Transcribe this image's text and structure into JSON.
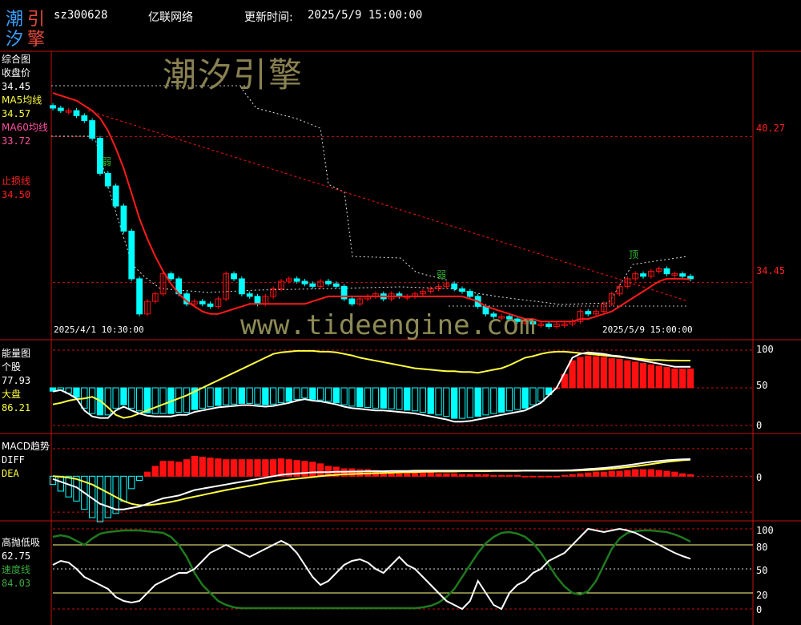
{
  "header": {
    "logo_chars": [
      "潮",
      "引",
      "汐",
      "擎"
    ],
    "stock_code": "sz300628",
    "stock_name": "亿联网络",
    "update_label": "更新时间:",
    "update_time": "2025/5/9 15:00:00"
  },
  "watermarks": {
    "brand": "潮汐引擎",
    "url": "www.tideengine.com"
  },
  "colors": {
    "up": "#ff1010",
    "down": "#00ffff",
    "ma60": "#ff1010",
    "diff": "#ffffff",
    "dea": "#ffff40",
    "speed": "#1f7a1f",
    "grid": "#c41010"
  },
  "panels": {
    "main": {
      "title": "综合图",
      "close_label": "收盘价",
      "close_value": "34.45",
      "ma5_label": "MA5均线",
      "ma5_value": "34.57",
      "ma60_label": "MA60均线",
      "ma60_value": "33.72",
      "stop_label": "止损线",
      "stop_value": "34.50",
      "right_axis": [
        "40.27",
        "34.45"
      ],
      "start_time": "2025/4/1 10:30:00",
      "end_time": "2025/5/9 15:00:00",
      "annotations": [
        "弱",
        "弱",
        "顶"
      ]
    },
    "energy": {
      "title": "能量图",
      "stock_label": "个股",
      "stock_value": "77.93",
      "market_label": "大盘",
      "market_value": "86.21",
      "right_axis": [
        "100",
        "50",
        "0"
      ]
    },
    "macd": {
      "title": "MACD趋势",
      "diff_label": "DIFF",
      "dea_label": "DEA",
      "right_axis": [
        "0"
      ]
    },
    "highlow": {
      "title": "高抛低吸",
      "value": "62.75",
      "speed_label": "速度线",
      "speed_value": "84.03",
      "right_axis": [
        "100",
        "80",
        "50",
        "20",
        "0"
      ]
    }
  },
  "chart_data": [
    {
      "type": "candlestick",
      "title": "综合图",
      "ylim": [
        32.3,
        43.6
      ],
      "x_start": "2025/4/1 10:30:00",
      "x_end": "2025/5/9 15:00:00",
      "close": [
        41.4,
        41.3,
        41.3,
        41.1,
        40.9,
        40.2,
        38.8,
        38.3,
        37.5,
        36.5,
        34.6,
        33.2,
        33.7,
        34.0,
        34.8,
        34.6,
        34.0,
        33.6,
        33.7,
        33.6,
        33.5,
        33.8,
        34.8,
        34.6,
        34.0,
        33.9,
        33.6,
        33.9,
        34.2,
        34.5,
        34.6,
        34.5,
        34.4,
        34.3,
        34.5,
        34.4,
        34.3,
        33.8,
        33.6,
        33.8,
        33.9,
        34.0,
        33.8,
        34.0,
        33.9,
        33.9,
        34.0,
        34.1,
        34.2,
        34.3,
        34.4,
        34.2,
        34.1,
        33.9,
        33.5,
        33.2,
        33.1,
        33.1,
        33.0,
        32.9,
        32.9,
        32.8,
        32.8,
        32.7,
        32.8,
        32.8,
        32.9,
        33.3,
        33.2,
        33.3,
        33.6,
        34.0,
        34.3,
        34.6,
        34.8,
        34.7,
        34.9,
        35.0,
        34.8,
        34.8,
        34.7,
        34.6
      ],
      "ma5": [
        42.0,
        41.9,
        41.8,
        41.7,
        41.5,
        41.3,
        41.0,
        40.5,
        39.8,
        39.0,
        38.0,
        37.0,
        36.2,
        35.5,
        34.9,
        34.4,
        34.0,
        33.7,
        33.5,
        33.3,
        33.2,
        33.2,
        33.3,
        33.4,
        33.5,
        33.6,
        33.6,
        33.6,
        33.6,
        33.6,
        33.6,
        33.6,
        33.6,
        33.7,
        33.8,
        33.9,
        33.9,
        33.9,
        33.9,
        33.9,
        33.9,
        33.9,
        33.9,
        33.9,
        33.9,
        33.9,
        33.9,
        33.9,
        33.9,
        33.9,
        33.9,
        33.9,
        33.9,
        33.8,
        33.7,
        33.5,
        33.4,
        33.3,
        33.2,
        33.1,
        33.0,
        33.0,
        32.9,
        32.9,
        32.9,
        32.9,
        32.9,
        33.0,
        33.0,
        33.1,
        33.2,
        33.3,
        33.5,
        33.7,
        33.9,
        34.1,
        34.3,
        34.5,
        34.6,
        34.6,
        34.6,
        34.57
      ],
      "ma60_range": [
        41.3,
        33.72
      ],
      "stop_line": [
        41.5,
        34.5
      ],
      "annotation_values": {
        "弱": 38.0,
        "顶": 35.1
      }
    },
    {
      "type": "bar+line",
      "title": "能量图",
      "ylim": [
        0,
        100
      ],
      "ticks": [
        0,
        50,
        100
      ],
      "series_names": [
        "个股",
        "大盘"
      ],
      "stock": [
        45,
        47,
        42,
        36,
        20,
        12,
        10,
        10,
        20,
        25,
        20,
        16,
        13,
        12,
        12,
        12,
        14,
        14,
        18,
        20,
        22,
        24,
        25,
        26,
        27,
        27,
        26,
        25,
        26,
        28,
        30,
        33,
        35,
        33,
        32,
        30,
        28,
        25,
        23,
        22,
        21,
        20,
        20,
        19,
        18,
        17,
        16,
        14,
        12,
        10,
        8,
        5,
        5,
        6,
        8,
        10,
        12,
        14,
        16,
        18,
        20,
        25,
        30,
        40,
        50,
        70,
        90,
        95,
        97,
        96,
        95,
        93,
        92,
        90,
        88,
        86,
        84,
        82,
        80,
        78,
        77.93,
        77.93
      ],
      "market": [
        28,
        30,
        33,
        35,
        36,
        38,
        33,
        24,
        14,
        10,
        12,
        16,
        20,
        24,
        28,
        32,
        36,
        40,
        45,
        50,
        55,
        60,
        65,
        70,
        75,
        80,
        85,
        90,
        95,
        97,
        98,
        99,
        99,
        99,
        98,
        98,
        97,
        95,
        93,
        90,
        88,
        86,
        84,
        82,
        80,
        78,
        76,
        75,
        74,
        73,
        72,
        72,
        71,
        71,
        70,
        72,
        74,
        76,
        80,
        85,
        90,
        92,
        95,
        97,
        98,
        98,
        97,
        96,
        95,
        94,
        93,
        92,
        91,
        90,
        89,
        88,
        87,
        87,
        86.5,
        86.3,
        86.21,
        86.21
      ]
    },
    {
      "type": "bar+line",
      "title": "MACD趋势",
      "ylim": [
        -1.5,
        1.2
      ],
      "series_names": [
        "DIFF",
        "DEA"
      ],
      "diff": [
        -0.1,
        -0.2,
        -0.3,
        -0.4,
        -0.6,
        -0.8,
        -1.0,
        -1.1,
        -1.2,
        -1.2,
        -1.15,
        -1.1,
        -1.0,
        -0.9,
        -0.8,
        -0.75,
        -0.7,
        -0.6,
        -0.5,
        -0.45,
        -0.4,
        -0.35,
        -0.3,
        -0.25,
        -0.2,
        -0.15,
        -0.1,
        -0.05,
        0,
        0.05,
        0.08,
        0.1,
        0.12,
        0.14,
        0.15,
        0.15,
        0.16,
        0.16,
        0.17,
        0.17,
        0.18,
        0.18,
        0.18,
        0.19,
        0.19,
        0.19,
        0.2,
        0.2,
        0.2,
        0.2,
        0.2,
        0.2,
        0.2,
        0.2,
        0.2,
        0.2,
        0.2,
        0.2,
        0.2,
        0.2,
        0.2,
        0.2,
        0.2,
        0.2,
        0.2,
        0.21,
        0.22,
        0.24,
        0.26,
        0.28,
        0.3,
        0.33,
        0.36,
        0.4,
        0.44,
        0.48,
        0.52,
        0.55,
        0.58,
        0.6,
        0.61,
        0.62
      ],
      "dea": [
        0.0,
        -0.02,
        -0.05,
        -0.1,
        -0.2,
        -0.3,
        -0.45,
        -0.6,
        -0.75,
        -0.9,
        -1.0,
        -1.05,
        -1.05,
        -1.02,
        -0.98,
        -0.93,
        -0.87,
        -0.8,
        -0.74,
        -0.68,
        -0.62,
        -0.56,
        -0.5,
        -0.45,
        -0.4,
        -0.35,
        -0.3,
        -0.25,
        -0.2,
        -0.16,
        -0.12,
        -0.09,
        -0.06,
        -0.03,
        0,
        0.03,
        0.05,
        0.07,
        0.08,
        0.09,
        0.1,
        0.11,
        0.12,
        0.13,
        0.14,
        0.15,
        0.15,
        0.16,
        0.16,
        0.17,
        0.17,
        0.17,
        0.18,
        0.18,
        0.18,
        0.18,
        0.19,
        0.19,
        0.19,
        0.19,
        0.2,
        0.2,
        0.2,
        0.2,
        0.2,
        0.2,
        0.2,
        0.21,
        0.22,
        0.23,
        0.25,
        0.27,
        0.3,
        0.33,
        0.36,
        0.4,
        0.44,
        0.48,
        0.52,
        0.55,
        0.58,
        0.6
      ]
    },
    {
      "type": "line",
      "title": "高抛低吸",
      "ylim": [
        0,
        100
      ],
      "ticks": [
        0,
        20,
        50,
        80,
        100
      ],
      "series_names": [
        "高抛低吸",
        "速度线"
      ],
      "value": [
        55,
        60,
        58,
        50,
        40,
        35,
        30,
        25,
        15,
        10,
        8,
        10,
        20,
        30,
        35,
        40,
        45,
        45,
        50,
        60,
        70,
        75,
        80,
        75,
        70,
        65,
        70,
        75,
        80,
        85,
        80,
        70,
        55,
        40,
        30,
        35,
        45,
        55,
        60,
        62,
        58,
        50,
        45,
        55,
        65,
        55,
        50,
        40,
        30,
        20,
        10,
        5,
        0,
        10,
        35,
        20,
        5,
        0,
        20,
        30,
        35,
        45,
        50,
        60,
        65,
        70,
        80,
        90,
        100,
        98,
        96,
        98,
        100,
        98,
        95,
        90,
        85,
        80,
        75,
        70,
        66,
        62.75
      ],
      "speed": [
        90,
        92,
        90,
        85,
        80,
        88,
        94,
        96,
        97,
        98,
        98,
        98,
        97,
        96,
        95,
        90,
        80,
        65,
        45,
        30,
        20,
        10,
        5,
        2,
        1,
        1,
        1,
        1,
        1,
        1,
        1,
        1,
        1,
        1,
        1,
        1,
        1,
        1,
        1,
        1,
        1,
        1,
        1,
        1,
        1,
        1,
        1,
        2,
        4,
        8,
        15,
        25,
        40,
        55,
        70,
        82,
        90,
        95,
        96,
        94,
        90,
        82,
        70,
        55,
        40,
        28,
        20,
        18,
        22,
        35,
        55,
        75,
        88,
        95,
        97,
        98,
        98,
        97,
        96,
        93,
        89,
        84.03
      ]
    }
  ]
}
